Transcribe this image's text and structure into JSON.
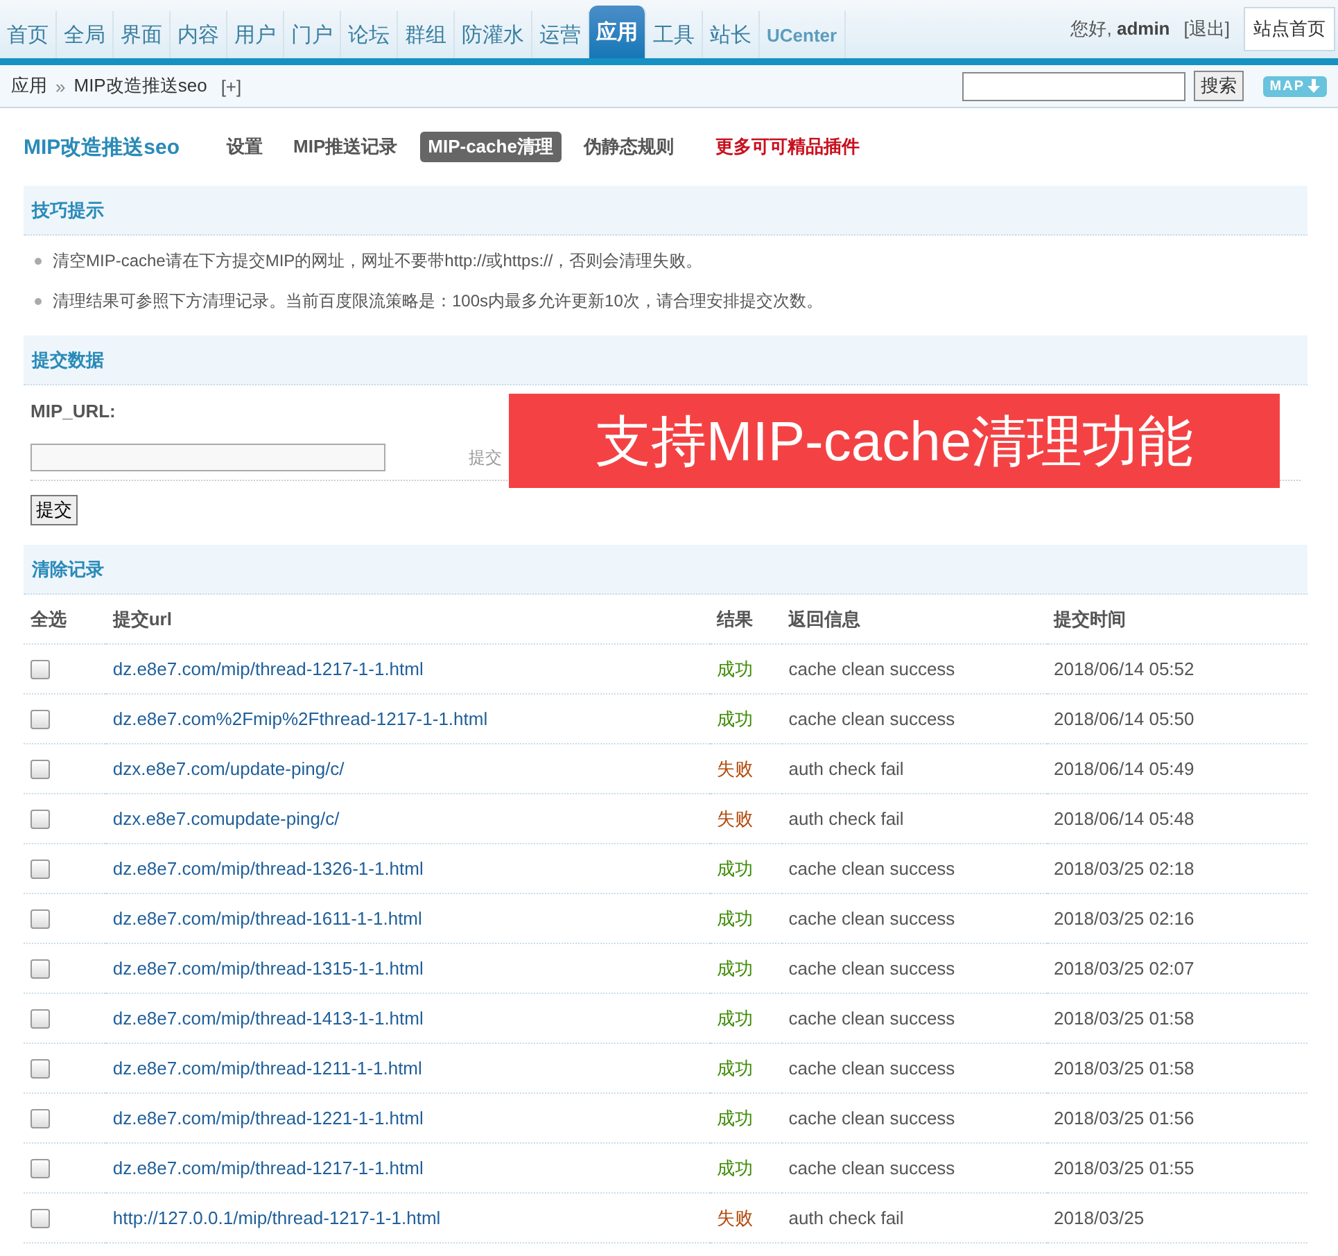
{
  "nav": {
    "items": [
      {
        "label": "首页",
        "selected": false
      },
      {
        "label": "全局",
        "selected": false
      },
      {
        "label": "界面",
        "selected": false
      },
      {
        "label": "内容",
        "selected": false
      },
      {
        "label": "用户",
        "selected": false
      },
      {
        "label": "门户",
        "selected": false
      },
      {
        "label": "论坛",
        "selected": false
      },
      {
        "label": "群组",
        "selected": false
      },
      {
        "label": "防灌水",
        "selected": false
      },
      {
        "label": "运营",
        "selected": false
      },
      {
        "label": "应用",
        "selected": true
      },
      {
        "label": "工具",
        "selected": false
      },
      {
        "label": "站长",
        "selected": false
      },
      {
        "label": "UCenter",
        "selected": false
      }
    ],
    "greeting": "您好,",
    "user": "admin",
    "logout": "[退出]",
    "site_home": "站点首页"
  },
  "breadcrumb": {
    "root": "应用",
    "separator": "»",
    "current": "MIP改造推送seo",
    "add": "[+]",
    "search_button": "搜索",
    "map_button": "MAP"
  },
  "plugin": {
    "title": "MIP改造推送seo",
    "tabs": [
      {
        "label": "设置",
        "selected": false
      },
      {
        "label": "MIP推送记录",
        "selected": false
      },
      {
        "label": "MIP-cache清理",
        "selected": true
      },
      {
        "label": "伪静态规则",
        "selected": false
      }
    ],
    "promo_link": "更多可可精品插件"
  },
  "tips": {
    "title": "技巧提示",
    "items": [
      "清空MIP-cache请在下方提交MIP的网址，网址不要带http://或https://，否则会清理失败。",
      "清理结果可参照下方清理记录。当前百度限流策略是：100s内最多允许更新10次，请合理安排提交次数。"
    ]
  },
  "form": {
    "title": "提交数据",
    "label": "MIP_URL:",
    "hint": "提交",
    "submit": "提交",
    "banner": "支持MIP-cache清理功能"
  },
  "records": {
    "title": "清除记录",
    "columns": [
      "全选",
      "提交url",
      "结果",
      "返回信息",
      "提交时间"
    ],
    "rows": [
      {
        "checked": false,
        "url": "dz.e8e7.com/mip/thread-1217-1-1.html",
        "kind": "success",
        "result": "成功",
        "message": "cache clean success",
        "time": "2018/06/14 05:52"
      },
      {
        "checked": false,
        "url": "dz.e8e7.com%2Fmip%2Fthread-1217-1-1.html",
        "kind": "success",
        "result": "成功",
        "message": "cache clean success",
        "time": "2018/06/14 05:50"
      },
      {
        "checked": false,
        "url": "dzx.e8e7.com/update-ping/c/",
        "kind": "fail",
        "result": "失败",
        "message": "auth check fail",
        "time": "2018/06/14 05:49"
      },
      {
        "checked": false,
        "url": "dzx.e8e7.comupdate-ping/c/",
        "kind": "fail",
        "result": "失败",
        "message": "auth check fail",
        "time": "2018/06/14 05:48"
      },
      {
        "checked": false,
        "url": "dz.e8e7.com/mip/thread-1326-1-1.html",
        "kind": "success",
        "result": "成功",
        "message": "cache clean success",
        "time": "2018/03/25 02:18"
      },
      {
        "checked": false,
        "url": "dz.e8e7.com/mip/thread-1611-1-1.html",
        "kind": "success",
        "result": "成功",
        "message": "cache clean success",
        "time": "2018/03/25 02:16"
      },
      {
        "checked": false,
        "url": "dz.e8e7.com/mip/thread-1315-1-1.html",
        "kind": "success",
        "result": "成功",
        "message": "cache clean success",
        "time": "2018/03/25 02:07"
      },
      {
        "checked": false,
        "url": "dz.e8e7.com/mip/thread-1413-1-1.html",
        "kind": "success",
        "result": "成功",
        "message": "cache clean success",
        "time": "2018/03/25 01:58"
      },
      {
        "checked": false,
        "url": "dz.e8e7.com/mip/thread-1211-1-1.html",
        "kind": "success",
        "result": "成功",
        "message": "cache clean success",
        "time": "2018/03/25 01:58"
      },
      {
        "checked": false,
        "url": "dz.e8e7.com/mip/thread-1221-1-1.html",
        "kind": "success",
        "result": "成功",
        "message": "cache clean success",
        "time": "2018/03/25 01:56"
      },
      {
        "checked": false,
        "url": "dz.e8e7.com/mip/thread-1217-1-1.html",
        "kind": "success",
        "result": "成功",
        "message": "cache clean success",
        "time": "2018/03/25 01:55"
      },
      {
        "checked": false,
        "url": "http://127.0.0.1/mip/thread-1217-1-1.html",
        "kind": "fail",
        "result": "失败",
        "message": "auth check fail",
        "time": "2018/03/25"
      }
    ]
  }
}
